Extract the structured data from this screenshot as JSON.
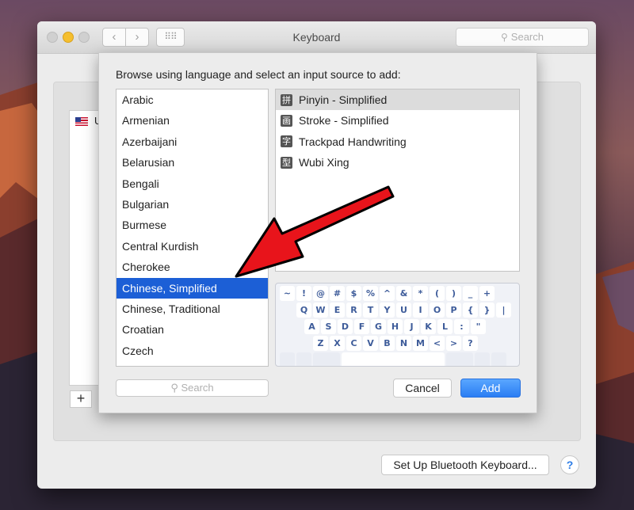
{
  "window": {
    "title": "Keyboard",
    "search_placeholder": "Search",
    "nav_back": "‹",
    "nav_forward": "›",
    "grid_icon": "⠿⠿"
  },
  "background_list": {
    "first_item_label": "U"
  },
  "bottom": {
    "plus_label": "+",
    "bluetooth_button": "Set Up Bluetooth Keyboard...",
    "help_label": "?"
  },
  "sheet": {
    "prompt": "Browse using language and select an input source to add:",
    "languages": [
      "Arabic",
      "Armenian",
      "Azerbaijani",
      "Belarusian",
      "Bengali",
      "Bulgarian",
      "Burmese",
      "Central Kurdish",
      "Cherokee",
      "Chinese, Simplified",
      "Chinese, Traditional",
      "Croatian",
      "Czech"
    ],
    "selected_language": "Chinese, Simplified",
    "input_sources": [
      {
        "icon": "拼",
        "label": "Pinyin - Simplified"
      },
      {
        "icon": "画",
        "label": "Stroke - Simplified"
      },
      {
        "icon": "字",
        "label": "Trackpad Handwriting"
      },
      {
        "icon": "型",
        "label": "Wubi Xing"
      }
    ],
    "selected_source": "Pinyin - Simplified",
    "keyboard_rows": [
      [
        "~",
        "!",
        "@",
        "#",
        "$",
        "%",
        "^",
        "&",
        "*",
        "(",
        ")",
        "_",
        "+"
      ],
      [
        "Q",
        "W",
        "E",
        "R",
        "T",
        "Y",
        "U",
        "I",
        "O",
        "P",
        "{",
        "}",
        "|"
      ],
      [
        "A",
        "S",
        "D",
        "F",
        "G",
        "H",
        "J",
        "K",
        "L",
        ":",
        "\""
      ],
      [
        "Z",
        "X",
        "C",
        "V",
        "B",
        "N",
        "M",
        "<",
        ">",
        "?"
      ]
    ],
    "search_placeholder": "Search",
    "cancel_label": "Cancel",
    "add_label": "Add"
  },
  "colors": {
    "selection_blue": "#1c5fd6",
    "add_button_blue": "#2a7df3",
    "arrow_red": "#e8141b"
  }
}
